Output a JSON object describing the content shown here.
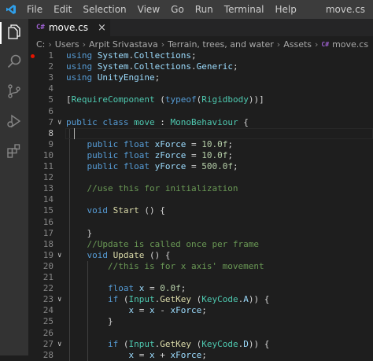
{
  "window": {
    "title": "move.cs",
    "menu": [
      "File",
      "Edit",
      "Selection",
      "View",
      "Go",
      "Run",
      "Terminal",
      "Help"
    ]
  },
  "activity_bar": [
    "explorer-icon",
    "search-icon",
    "source-control-icon",
    "run-debug-icon",
    "extensions-icon"
  ],
  "tab": {
    "icon": "C#",
    "label": "move.cs",
    "close": "×"
  },
  "breadcrumb": {
    "items": [
      "C:",
      "Users",
      "Arpit Srivastava",
      "Terrain, trees, and water",
      "Assets",
      "move.cs"
    ],
    "file_icon": "C#"
  },
  "colors": {
    "keyword": "#569cd6",
    "type": "#4ec9b0",
    "number": "#b5cea8",
    "comment": "#6a9955",
    "function": "#dcdcaa",
    "breakpoint": "#e51400"
  },
  "editor": {
    "current_line": 8,
    "lines": [
      {
        "n": "1",
        "code": "using System.Collections;"
      },
      {
        "n": "2",
        "code": "using System.Collections.Generic;"
      },
      {
        "n": "3",
        "code": "using UnityEngine;"
      },
      {
        "n": "4",
        "code": ""
      },
      {
        "n": "5",
        "code": "[RequireComponent (typeof(Rigidbody))]"
      },
      {
        "n": "6",
        "code": ""
      },
      {
        "n": "7",
        "code": "public class move : MonoBehaviour {"
      },
      {
        "n": "8",
        "code": ""
      },
      {
        "n": "9",
        "code": "    public float xForce = 10.0f;"
      },
      {
        "n": "10",
        "code": "    public float zForce = 10.0f;"
      },
      {
        "n": "11",
        "code": "    public float yForce = 500.0f;"
      },
      {
        "n": "12",
        "code": ""
      },
      {
        "n": "13",
        "code": "    //use this for initialization"
      },
      {
        "n": "14",
        "code": ""
      },
      {
        "n": "15",
        "code": "    void Start () {"
      },
      {
        "n": "16",
        "code": ""
      },
      {
        "n": "17",
        "code": "    }"
      },
      {
        "n": "18",
        "code": "    //Update is called once per frame"
      },
      {
        "n": "19",
        "code": "    void Update () {"
      },
      {
        "n": "20",
        "code": "        //this is for x axis' movement"
      },
      {
        "n": "21",
        "code": ""
      },
      {
        "n": "22",
        "code": "        float x = 0.0f;"
      },
      {
        "n": "23",
        "code": "        if (Input.GetKey (KeyCode.A)) {"
      },
      {
        "n": "24",
        "code": "            x = x - xForce;"
      },
      {
        "n": "25",
        "code": "        }"
      },
      {
        "n": "26",
        "code": ""
      },
      {
        "n": "27",
        "code": "        if (Input.GetKey (KeyCode.D)) {"
      },
      {
        "n": "28",
        "code": "            x = x + xForce;"
      }
    ]
  }
}
